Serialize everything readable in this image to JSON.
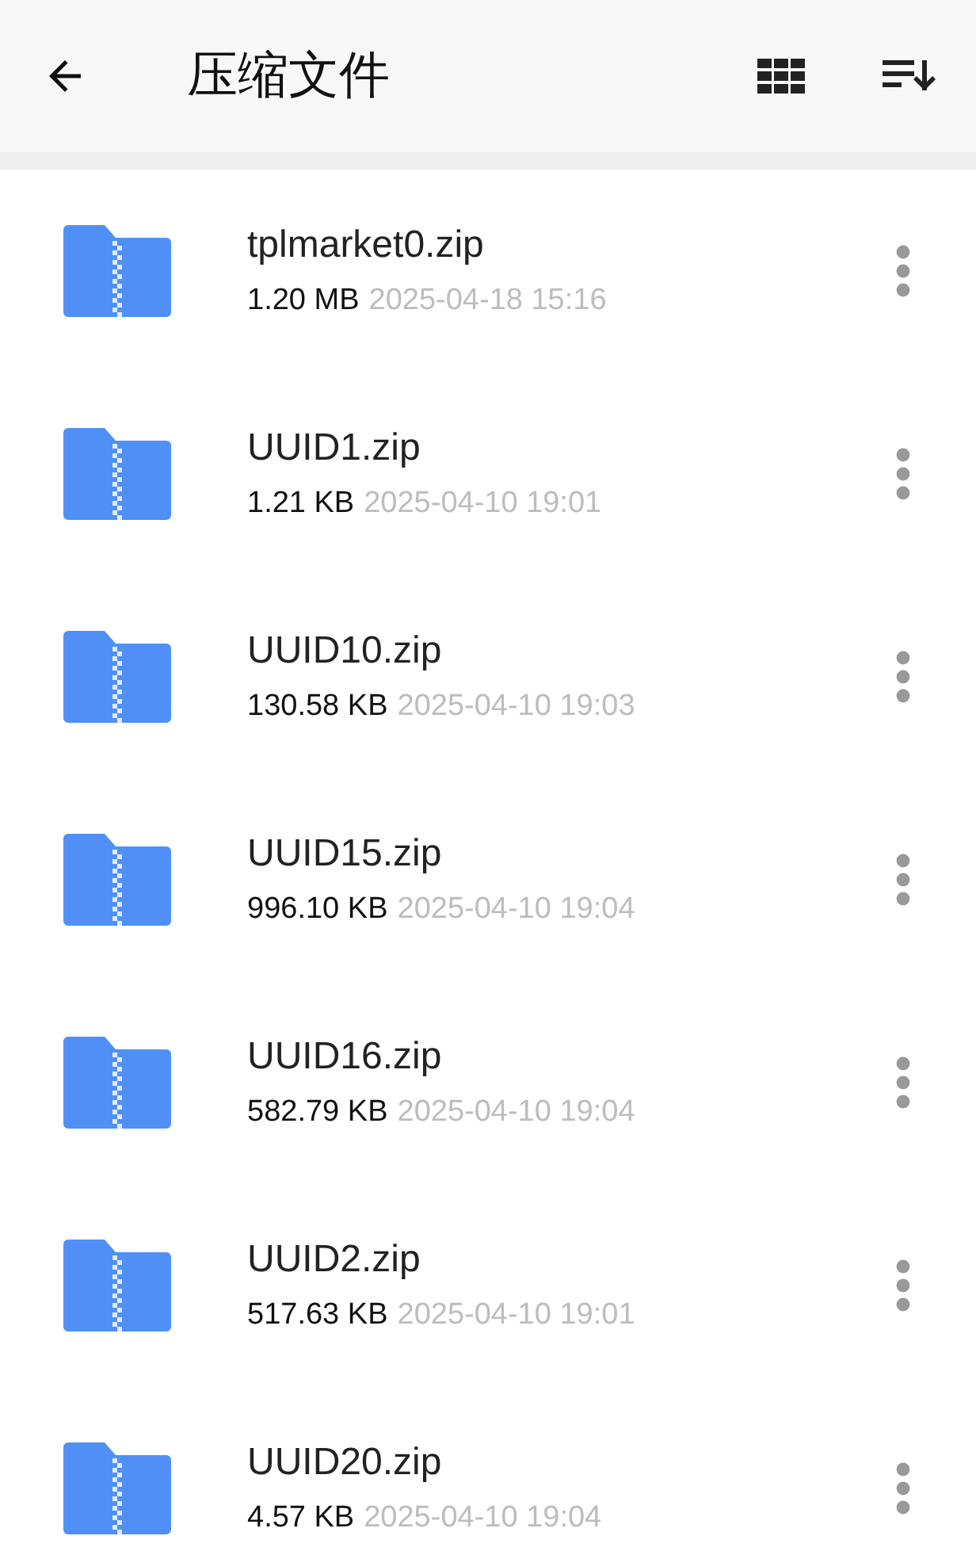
{
  "header": {
    "title": "压缩文件"
  },
  "files": [
    {
      "name": "tplmarket0.zip",
      "size": "1.20 MB",
      "date": "2025-04-18 15:16"
    },
    {
      "name": "UUID1.zip",
      "size": "1.21 KB",
      "date": "2025-04-10 19:01"
    },
    {
      "name": "UUID10.zip",
      "size": "130.58 KB",
      "date": "2025-04-10 19:03"
    },
    {
      "name": "UUID15.zip",
      "size": "996.10 KB",
      "date": "2025-04-10 19:04"
    },
    {
      "name": "UUID16.zip",
      "size": "582.79 KB",
      "date": "2025-04-10 19:04"
    },
    {
      "name": "UUID2.zip",
      "size": "517.63 KB",
      "date": "2025-04-10 19:01"
    },
    {
      "name": "UUID20.zip",
      "size": "4.57 KB",
      "date": "2025-04-10 19:04"
    }
  ]
}
